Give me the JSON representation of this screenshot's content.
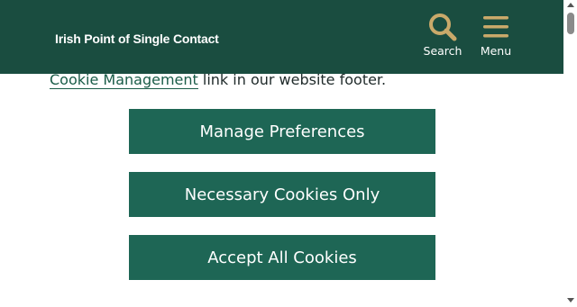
{
  "header": {
    "site_title": "Irish Point of Single Contact",
    "search_label": "Search",
    "menu_label": "Menu",
    "icon_color": "#c9a96a",
    "background": "#1a4d40"
  },
  "cookie_banner": {
    "link_text": "Cookie Management",
    "trailing_text": " link in our website footer.",
    "buttons": {
      "manage": "Manage Preferences",
      "necessary": "Necessary Cookies Only",
      "accept": "Accept All Cookies"
    },
    "button_color": "#1e6655"
  }
}
